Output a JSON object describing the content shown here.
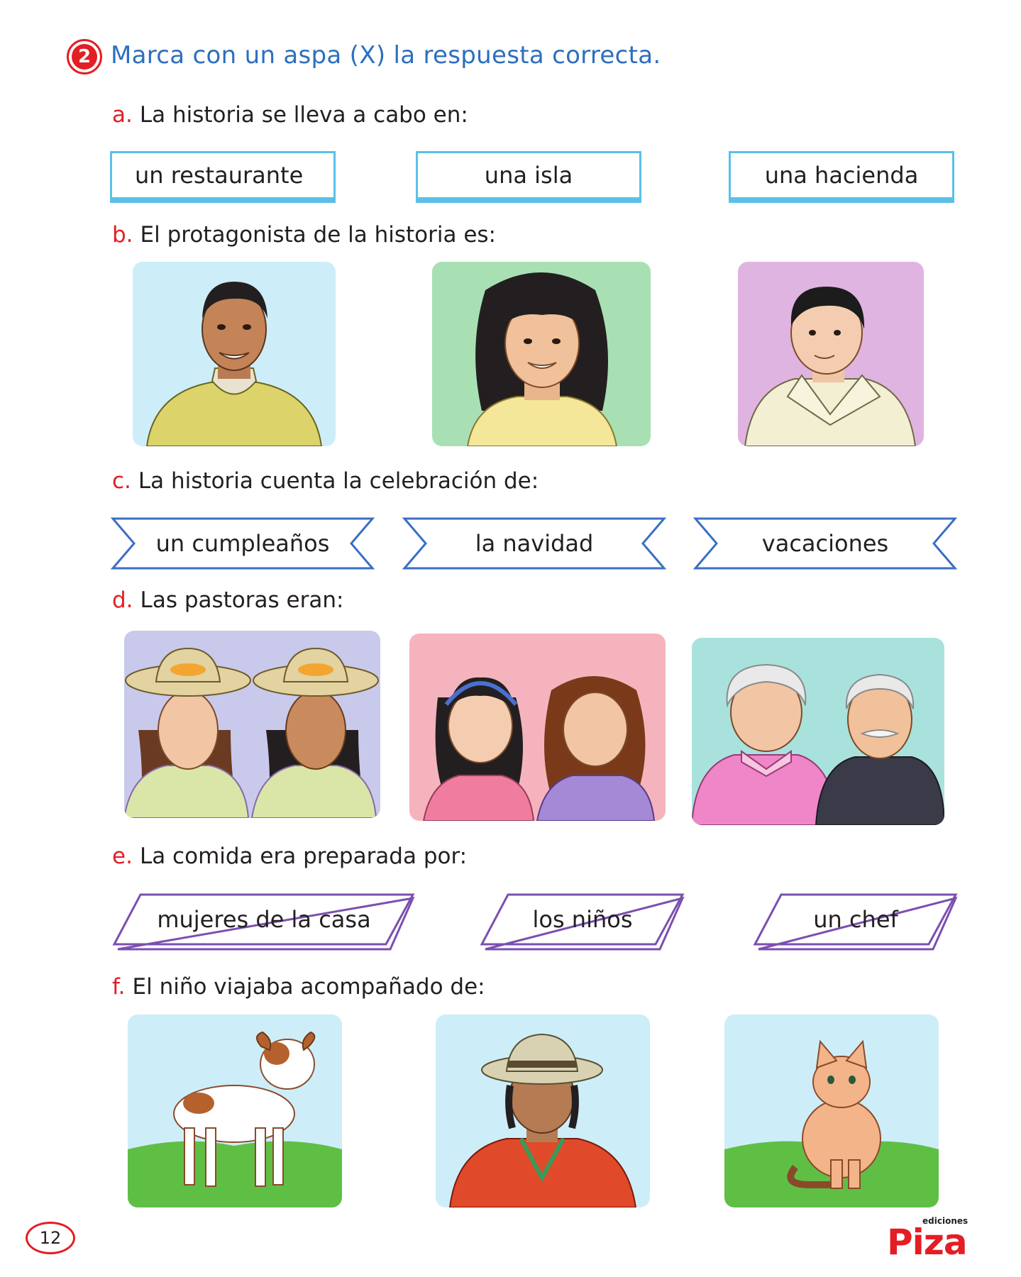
{
  "header": {
    "number": "2",
    "instruction": "Marca con un aspa (X) la respuesta correcta."
  },
  "questions": {
    "a": {
      "letter": "a.",
      "text": "La historia se lleva a cabo en:",
      "options": [
        "un restaurante",
        "una isla",
        "una hacienda"
      ]
    },
    "b": {
      "letter": "b.",
      "text": "El protagonista de la historia es:",
      "images": [
        "adult-man-portrait",
        "woman-portrait",
        "boy-portrait"
      ]
    },
    "c": {
      "letter": "c.",
      "text": "La historia cuenta la celebración de:",
      "options": [
        "un cumpleaños",
        "la navidad",
        "vacaciones"
      ]
    },
    "d": {
      "letter": "d.",
      "text": "Las pastoras eran:",
      "images": [
        "two-young-women-with-hats",
        "two-girls",
        "elderly-couple"
      ]
    },
    "e": {
      "letter": "e.",
      "text": "La comida era preparada por:",
      "options": [
        "mujeres de la casa",
        "los niños",
        "un chef"
      ]
    },
    "f": {
      "letter": "f.",
      "text": "El niño viajaba acompañado de:",
      "images": [
        "dog",
        "andean-man-with-hat",
        "cat"
      ]
    }
  },
  "footer": {
    "page_number": "12",
    "logo_small": "ediciones",
    "logo_main": "Piza"
  },
  "colors": {
    "accent_red": "#e31e24",
    "instruction_blue": "#2c6fbf",
    "box_cyan": "#5bc0e8",
    "ribbon_blue": "#3a6fc4",
    "para_purple": "#7b4fb0"
  }
}
